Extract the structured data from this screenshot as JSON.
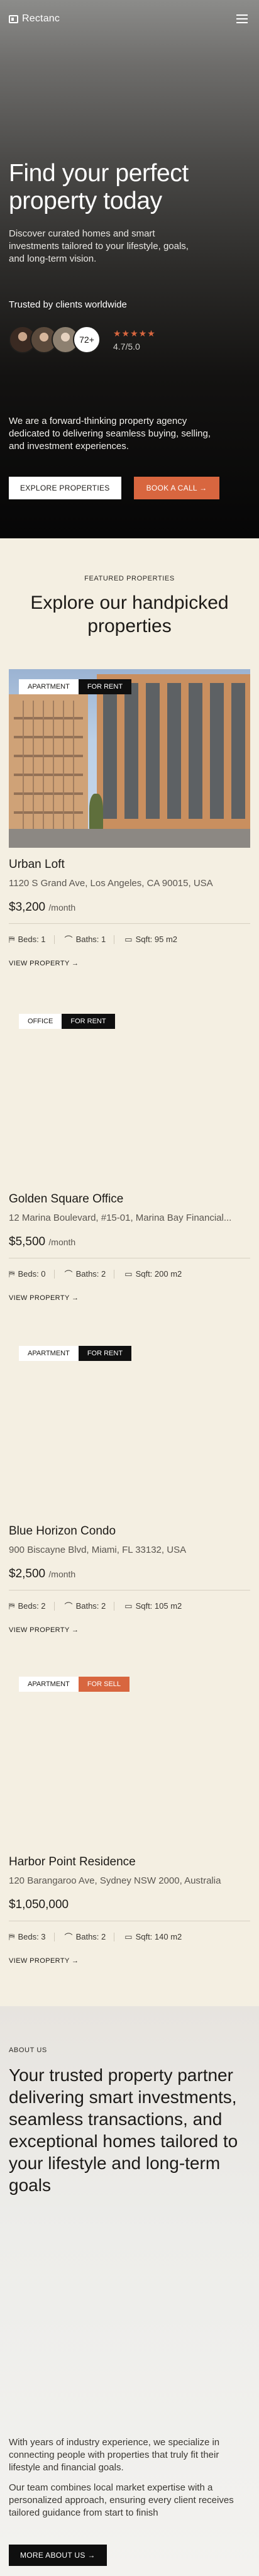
{
  "nav": {
    "brand": "Rectanc"
  },
  "hero": {
    "title": "Find your perfect property today",
    "subtitle": "Discover curated homes and smart investments tailored to your lifestyle, goals, and long-term vision.",
    "trusted": "Trusted by clients worldwide",
    "client_count": "72+",
    "stars": "★★★★★",
    "rating": "4.7/5.0",
    "about": "We are a forward-thinking property agency dedicated to delivering seamless buying, selling, and investment experiences.",
    "cta_primary": "EXPLORE PROPERTIES",
    "cta_secondary": "BOOK A CALL →"
  },
  "featured": {
    "eyebrow": "FEATURED PROPERTIES",
    "title": "Explore our handpicked properties",
    "listings": [
      {
        "type": "APARTMENT",
        "status": "FOR RENT",
        "name": "Urban Loft",
        "address": "1120 S Grand Ave, Los Angeles, CA 90015, USA",
        "price": "$3,200",
        "period": "/month",
        "beds": "Beds: 1",
        "baths": "Baths: 1",
        "sqft": "Sqft: 95 m2",
        "link": "VIEW PROPERTY →"
      },
      {
        "type": "OFFICE",
        "status": "FOR RENT",
        "name": "Golden Square Office",
        "address": "12 Marina Boulevard, #15-01, Marina Bay Financial...",
        "price": "$5,500",
        "period": "/month",
        "beds": "Beds: 0",
        "baths": "Baths: 2",
        "sqft": "Sqft: 200 m2",
        "link": "VIEW PROPERTY →"
      },
      {
        "type": "APARTMENT",
        "status": "FOR RENT",
        "name": "Blue Horizon Condo",
        "address": "900 Biscayne Blvd, Miami, FL 33132, USA",
        "price": "$2,500",
        "period": "/month",
        "beds": "Beds: 2",
        "baths": "Baths: 2",
        "sqft": "Sqft: 105 m2",
        "link": "VIEW PROPERTY →"
      },
      {
        "type": "APARTMENT",
        "status": "FOR SELL",
        "name": "Harbor Point Residence",
        "address": "120 Barangaroo Ave, Sydney NSW 2000, Australia",
        "price": "$1,050,000",
        "period": "",
        "beds": "Beds: 3",
        "baths": "Baths: 2",
        "sqft": "Sqft: 140 m2",
        "link": "VIEW PROPERTY →"
      }
    ]
  },
  "about": {
    "eyebrow": "ABOUT US",
    "title": "Your trusted property partner delivering smart investments, seamless transactions, and exceptional homes tailored to your lifestyle and long-term goals",
    "p1": "With years of industry experience, we specialize in connecting people with properties that truly fit their lifestyle and financial goals.",
    "p2": "Our team combines local market expertise with a personalized approach, ensuring every client receives tailored guidance from start to finish",
    "button": "MORE ABOUT US →"
  },
  "colors": {
    "accent": "#d8663f",
    "dark": "#0f0f0f",
    "cream": "#f4efe2"
  }
}
